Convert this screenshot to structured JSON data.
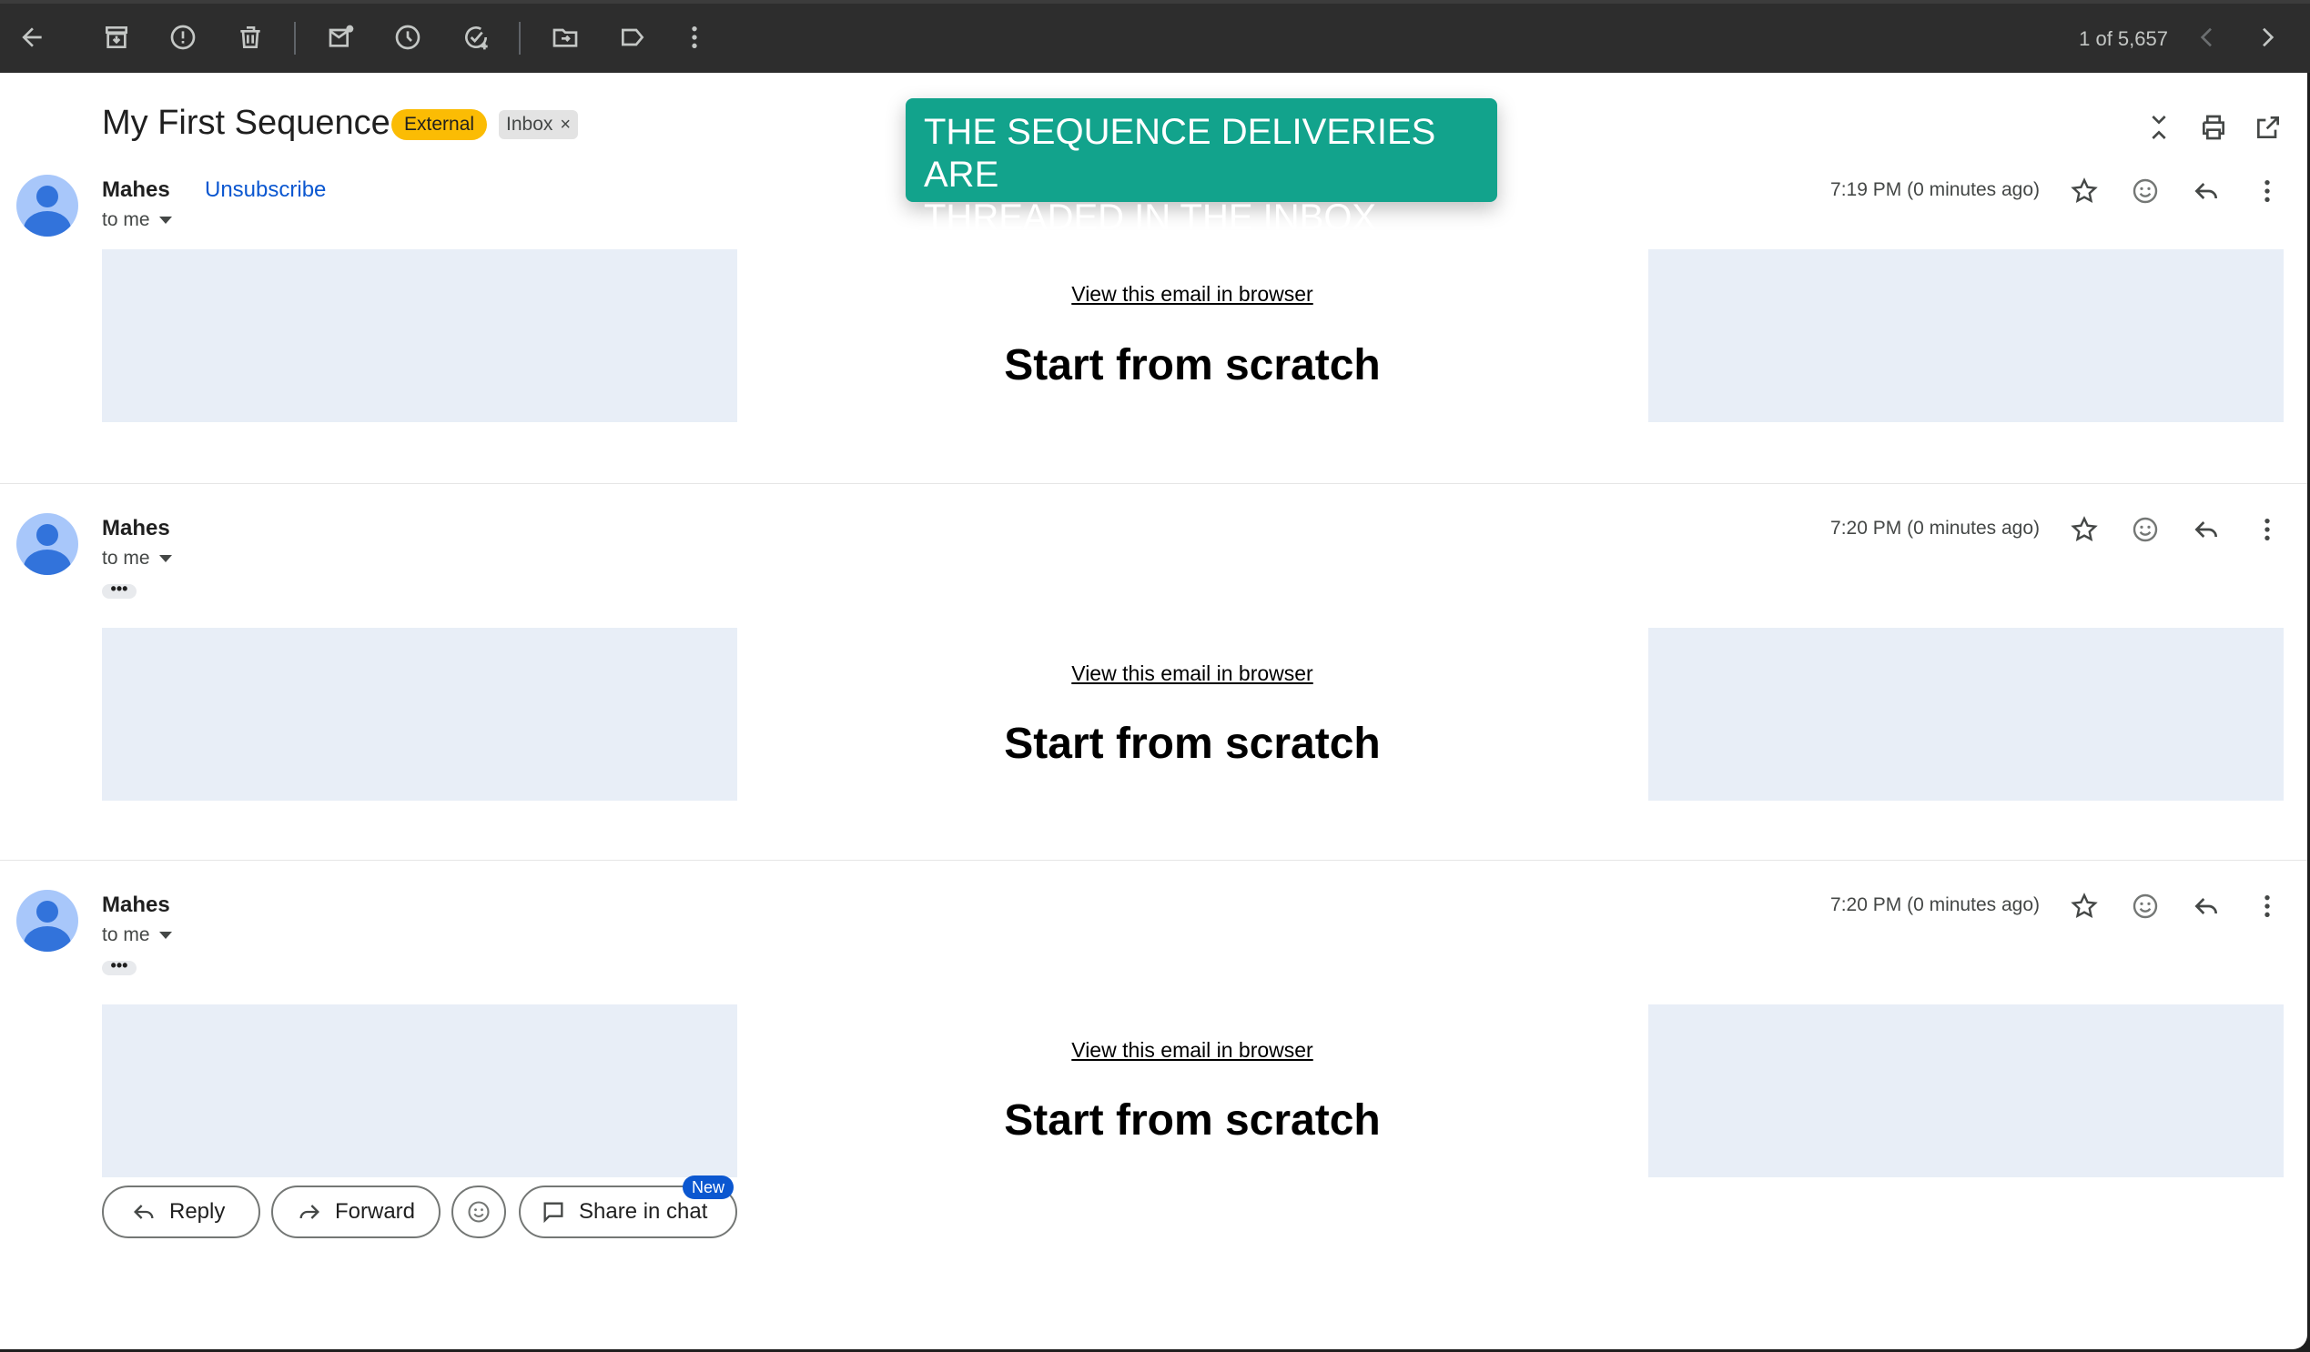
{
  "toolbar": {
    "count": "1 of 5,657",
    "icons": [
      "back-arrow-icon",
      "archive-icon",
      "report-spam-icon",
      "delete-icon",
      "mark-unread-icon",
      "snooze-icon",
      "add-task-icon",
      "move-to-icon",
      "label-icon",
      "more-vert-icon",
      "chevron-left-icon",
      "chevron-right-icon"
    ]
  },
  "thread": {
    "subject": "My First Sequence",
    "label_external": "External",
    "label_inbox": "Inbox",
    "label_inbox_close": "×"
  },
  "callout": {
    "line1": "THE SEQUENCE DELIVERIES ARE",
    "line2": "THREADED IN THE INBOX"
  },
  "messages": [
    {
      "sender": "Mahes",
      "unsubscribe": "Unsubscribe",
      "to": "to me",
      "time": "7:19 PM (0 minutes ago)",
      "view_link": "View this email in browser",
      "heading": "Start from scratch"
    },
    {
      "sender": "Mahes",
      "to": "to me",
      "dots": "•••",
      "time": "7:20 PM (0 minutes ago)",
      "view_link": "View this email in browser",
      "heading": "Start from scratch"
    },
    {
      "sender": "Mahes",
      "to": "to me",
      "dots": "•••",
      "time": "7:20 PM (0 minutes ago)",
      "view_link": "View this email in browser",
      "heading": "Start from scratch"
    }
  ],
  "actions": {
    "reply": "Reply",
    "forward": "Forward",
    "share_in_chat": "Share in chat",
    "new_badge": "New"
  }
}
